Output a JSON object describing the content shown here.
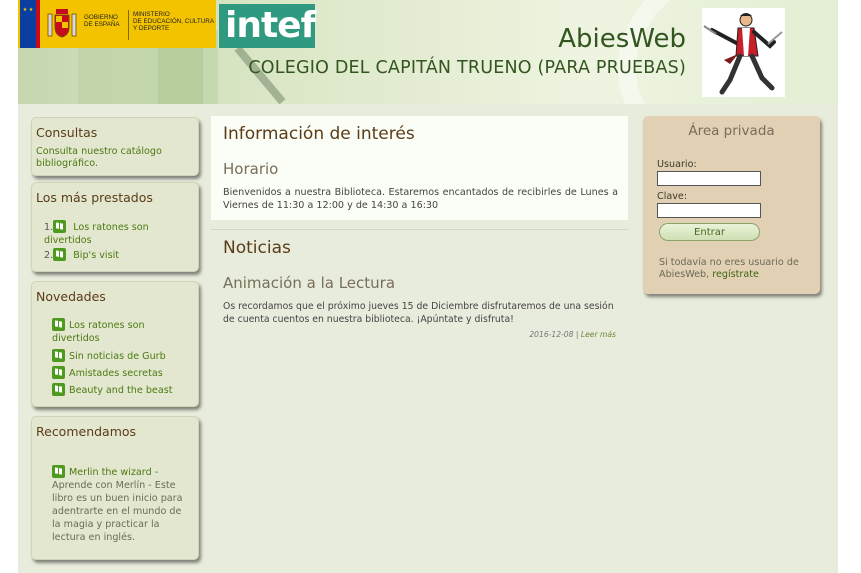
{
  "header": {
    "gov_line1": "GOBIERNO\nDE ESPAÑA",
    "gov_line2": "MINISTERIO\nDE EDUCACIÓN, CULTURA\nY DEPORTE",
    "intef_logo": "intef",
    "site_name": "AbiesWeb",
    "school_name": "COLEGIO DEL CAPITÁN TRUENO (PARA PRUEBAS)"
  },
  "sidebar": {
    "consultas": {
      "title": "Consultas",
      "link": "Consulta nuestro catálogo bibliográfico."
    },
    "mas_prestados": {
      "title": "Los más prestados",
      "items": [
        {
          "num": "1.",
          "label": "Los ratones son divertidos"
        },
        {
          "num": "2.",
          "label": "Bip's visit"
        }
      ]
    },
    "novedades": {
      "title": "Novedades",
      "items": [
        {
          "label": "Los ratones son divertidos"
        },
        {
          "label": "Sin noticias de Gurb"
        },
        {
          "label": "Amistades secretas"
        },
        {
          "label": "Beauty and the beast"
        }
      ]
    },
    "recomendamos": {
      "title": "Recomendamos",
      "item_title": "Merlin the wizard",
      "item_desc": " - Aprende con Merlín - Este libro es un buen inicio para adentrarte en el mundo de la magia y practicar la lectura en inglés."
    }
  },
  "main": {
    "info": {
      "title": "Información de interés",
      "schedule_title": "Horario",
      "schedule_text": "Bienvenidos a nuestra Biblioteca. Estaremos encantados de recibirles de Lunes a Viernes de 11:30 a 12:00 y de 14:30 a 16:30"
    },
    "news": {
      "title": "Noticias",
      "item_title": "Animación a la Lectura",
      "item_text": "Os recordamos que el próximo jueves 15 de Diciembre disfrutaremos de una sesión de cuenta cuentos en nuestra biblioteca. ¡Apúntate y disfruta!",
      "date": "2016-12-08",
      "separator": " | ",
      "read_more": "Leer más"
    }
  },
  "login": {
    "title": "Área privada",
    "user_label": "Usuario:",
    "user_value": "",
    "password_label": "Clave:",
    "password_value": "",
    "submit": "Entrar",
    "register_text": "Si todavía no eres usuario de AbiesWeb, ",
    "register_link": "regístrate"
  },
  "colors": {
    "accent_green": "#4c7a12",
    "title_brown": "#5a3c18",
    "sidebar_bg": "#e3e7cf",
    "login_bg": "#e2d0b5",
    "intef_teal": "#2f9a80"
  },
  "icons": {
    "book": "book-icon",
    "mascot": "captain-trueno-mascot",
    "coat_of_arms": "spain-coat-of-arms-icon"
  }
}
